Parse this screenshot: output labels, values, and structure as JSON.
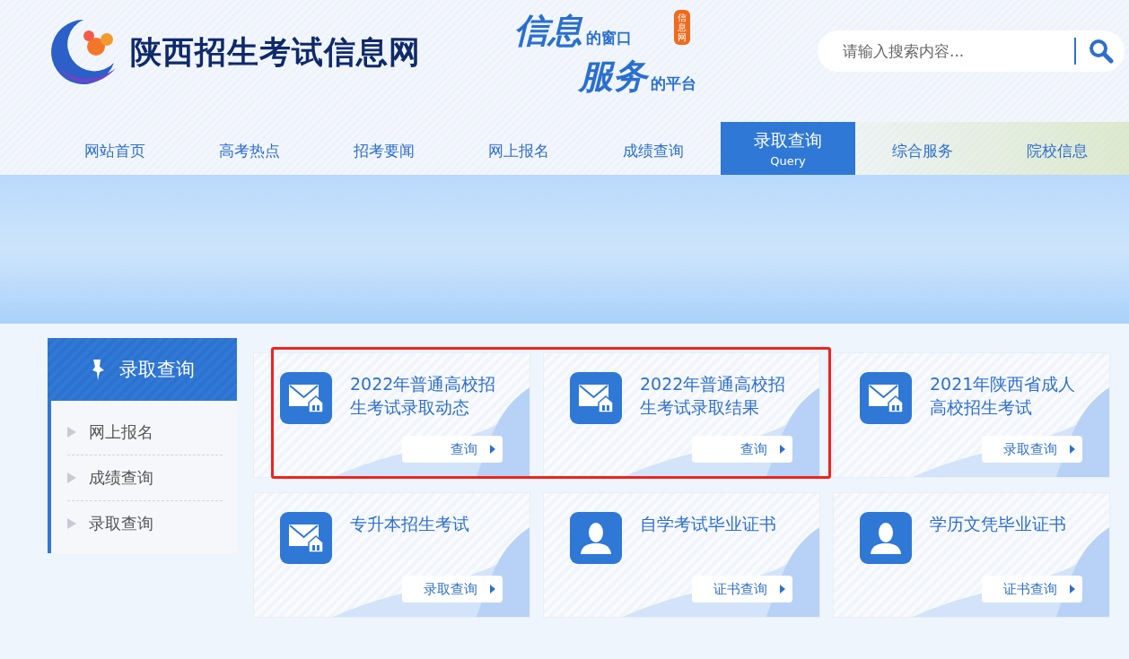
{
  "site": {
    "name": "陕西招生考试信息网",
    "slogan": [
      {
        "big": "信息",
        "small": "的窗口"
      },
      {
        "big": "服务",
        "small": "的平台"
      }
    ],
    "badge": "信息网"
  },
  "search": {
    "placeholder": "请输入搜索内容..."
  },
  "nav": [
    {
      "label": "网站首页",
      "selected": false
    },
    {
      "label": "高考热点",
      "selected": false
    },
    {
      "label": "招考要闻",
      "selected": false
    },
    {
      "label": "网上报名",
      "selected": false
    },
    {
      "label": "成绩查询",
      "selected": false
    },
    {
      "label": "录取查询",
      "subtitle": "Query",
      "selected": true
    },
    {
      "label": "综合服务",
      "selected": false
    },
    {
      "label": "院校信息",
      "selected": false
    }
  ],
  "sidebar": {
    "title": "录取查询",
    "items": [
      "网上报名",
      "成绩查询",
      "录取查询"
    ]
  },
  "cards": [
    {
      "kind": "mail",
      "title": "2022年普通高校招生考试录取动态",
      "button": "查询",
      "highlighted": true
    },
    {
      "kind": "mail",
      "title": "2022年普通高校招生考试录取结果",
      "button": "查询",
      "highlighted": true
    },
    {
      "kind": "mail",
      "title": "2021年陕西省成人高校招生考试",
      "button": "录取查询",
      "highlighted": false
    },
    {
      "kind": "mail",
      "title": "专升本招生考试",
      "button": "录取查询",
      "highlighted": false
    },
    {
      "kind": "person",
      "title": "自学考试毕业证书",
      "button": "证书查询",
      "highlighted": false
    },
    {
      "kind": "person",
      "title": "学历文凭毕业证书",
      "button": "证书查询",
      "highlighted": false
    }
  ]
}
